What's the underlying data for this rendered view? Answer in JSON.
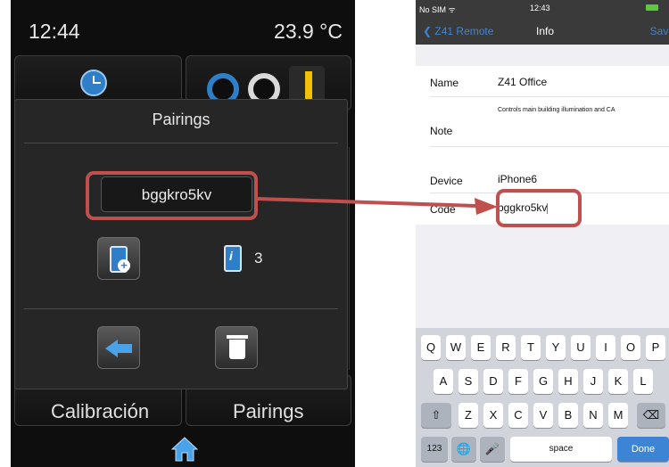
{
  "left_device": {
    "time": "12:44",
    "temperature": "23.9 °C",
    "bottom_tiles": {
      "left": "Calibración",
      "right": "Pairings"
    },
    "dialog": {
      "title": "Pairings",
      "code": "bggkro5kv",
      "paired_count": "3",
      "icons": [
        "add-device-icon",
        "device-info-icon",
        "back-arrow-icon",
        "trash-icon",
        "home-icon"
      ]
    }
  },
  "right_phone": {
    "status": {
      "carrier": "No SIM ᯤ",
      "time": "12:43"
    },
    "nav": {
      "back_label": "Z41 Remote",
      "title": "Info",
      "save_label": "Save"
    },
    "form": {
      "name_label": "Name",
      "name_value": "Z41 Office",
      "note_label": "Note",
      "note_value": "Controls main building illumination and CA",
      "device_label": "Device",
      "device_value": "iPhone6",
      "code_label": "Code",
      "code_value": "bggkro5kv"
    },
    "keyboard": {
      "row1": [
        "Q",
        "W",
        "E",
        "R",
        "T",
        "Y",
        "U",
        "I",
        "O",
        "P"
      ],
      "row2": [
        "A",
        "S",
        "D",
        "F",
        "G",
        "H",
        "J",
        "K",
        "L"
      ],
      "row3": [
        "Z",
        "X",
        "C",
        "V",
        "B",
        "N",
        "M"
      ],
      "numbers_key": "123",
      "space_key": "space",
      "done_key": "Done"
    }
  },
  "colors": {
    "highlight": "#c0504d",
    "ios_blue": "#3e84d4",
    "device_bg": "#0e0e0e"
  }
}
